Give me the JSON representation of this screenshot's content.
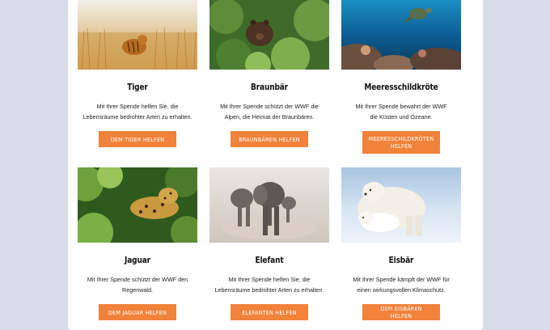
{
  "animals": [
    {
      "key": "tiger",
      "title": "Tiger",
      "description": "Mit Ihrer Spende helfen Sie, die Lebensräume bedrohter Arten zu erhalten.",
      "button": "DEM TIGER HELFEN"
    },
    {
      "key": "braunbaer",
      "title": "Braunbär",
      "description": "Mit Ihrer Spende schützt der WWF die Alpen, die Heimat der Braunbären.",
      "button": "BRAUNBÄREN HELFEN"
    },
    {
      "key": "meeresschildkroete",
      "title": "Meeresschildkröte",
      "description": "Mit Ihrer Spende bewahrt der WWF die Küsten und Ozeane.",
      "button": "MEERESSCHILDKRÖTEN HELFEN"
    },
    {
      "key": "jaguar",
      "title": "Jaguar",
      "description": "Mit Ihrer Spende schützt der WWF den Regenwald.",
      "button": "DEM JAGUAR HELFEN"
    },
    {
      "key": "elefant",
      "title": "Elefant",
      "description": "Mit Ihrer Spende helfen Sie, die Lebensräume bedrohter Arten zu erhalten.",
      "button": "ELEFANTEN HELFEN"
    },
    {
      "key": "eisbaer",
      "title": "Eisbär",
      "description": "Mit Ihrer Spende kämpft der WWF für einen wirkungsvollen Klimaschutz.",
      "button": "DEM EISBÄREN HELFEN"
    }
  ],
  "colors": {
    "accent": "#f0823a",
    "page_bg": "#d9dde7",
    "card_bg": "#ffffff"
  },
  "icons": [
    "tiger-photo",
    "brown-bear-photo",
    "sea-turtle-photo",
    "jaguar-photo",
    "elephant-photo",
    "polar-bear-photo"
  ]
}
